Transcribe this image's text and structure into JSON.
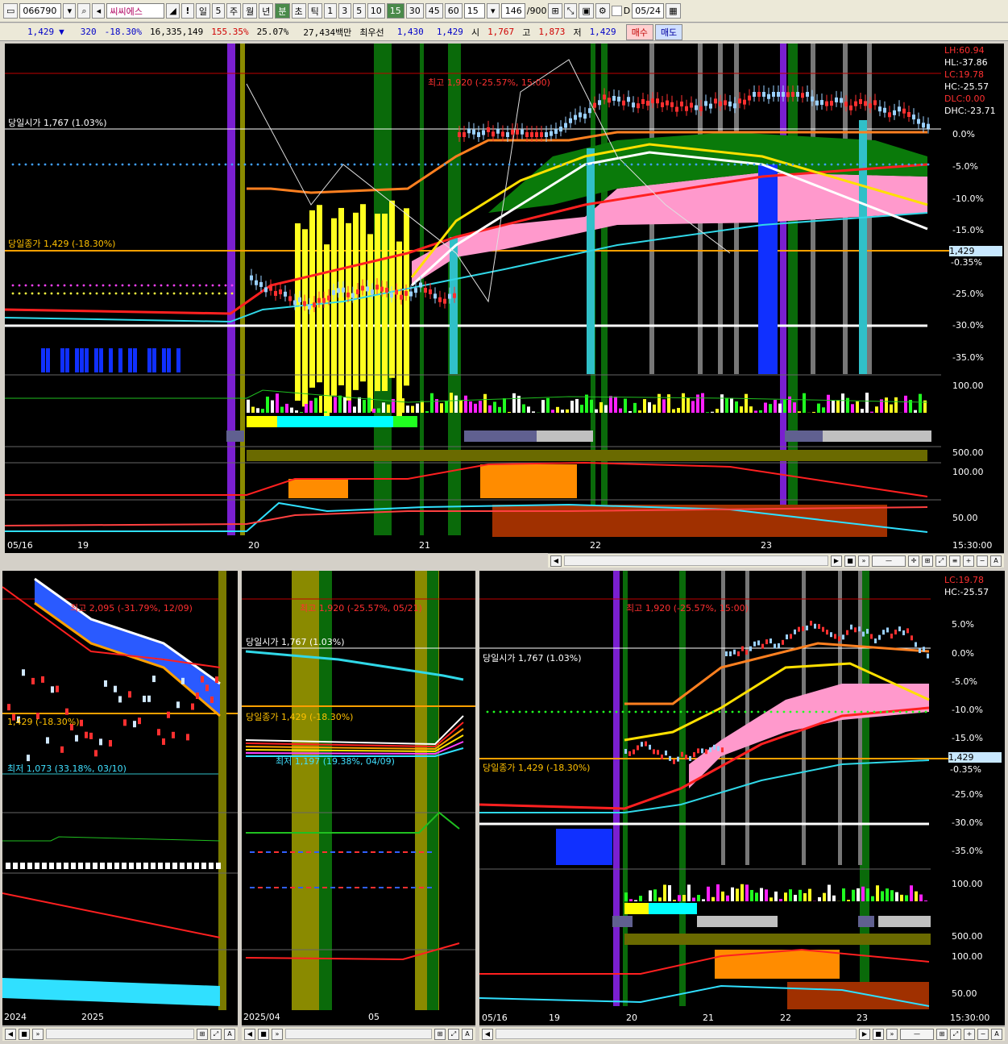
{
  "toolbar": {
    "code": "066790",
    "name": "씨씨에스",
    "periods": [
      "일",
      "5",
      "주",
      "월",
      "년",
      "분",
      "초",
      "틱"
    ],
    "intervals": [
      "1",
      "3",
      "5",
      "10",
      "15",
      "30",
      "45",
      "60"
    ],
    "interval_current": "15",
    "count": "146",
    "count_total": "/900",
    "date": "05/24",
    "checkbox_label": "D"
  },
  "quote": {
    "price": "1,429",
    "arrow": "▼",
    "change": "320",
    "change_pct": "-18.30%",
    "volume": "16,335,149",
    "volume_ratio": "155.35%",
    "turnover": "25.07%",
    "amount": "27,434백만",
    "best_bid_label": "최우선",
    "best_ask": "1,430",
    "best_bid": "1,429",
    "open_label": "시",
    "open": "1,767",
    "high_label": "고",
    "high": "1,873",
    "low_label": "저",
    "low": "1,429",
    "buy_label": "매수",
    "sell_label": "매도"
  },
  "main_chart": {
    "right_labels": [
      {
        "text": "LH:60.94",
        "color": "#ff3030"
      },
      {
        "text": "HL:-37.86",
        "color": "#ffffff"
      },
      {
        "text": "LC:19.78",
        "color": "#ff3030"
      },
      {
        "text": "HC:-25.57",
        "color": "#ffffff"
      },
      {
        "text": "DLC:0.00",
        "color": "#ff3030"
      },
      {
        "text": "DHC:-23.71",
        "color": "#ffffff"
      }
    ],
    "pct_ticks": [
      "0.0%",
      "-5.0%",
      "-10.0%",
      "-15.0%",
      "-25.0%",
      "-30.0%",
      "-35.0%"
    ],
    "price_tag": "1,429",
    "price_tag_pct": "-0.35%",
    "high_annotation": "최고 1,920 (-25.57%, 15:00)",
    "open_annotation": "당일시가 1,767 (1.03%)",
    "close_annotation": "당일종가 1,429 (-18.30%)",
    "sub_ticks": [
      "100.00",
      "500.00",
      "100.00",
      "50.00"
    ],
    "dates": [
      "05/16",
      "19",
      "20",
      "21",
      "22",
      "23"
    ],
    "time": "15:30:00"
  },
  "bottom_left": {
    "high_annotation": "최고 2,095 (-31.79%, 12/09)",
    "close_annotation": "1,429 (-18.30%)",
    "low_annotation": "최저 1,073 (33.18%, 03/10)",
    "dates": [
      "2024",
      "2025"
    ]
  },
  "bottom_mid": {
    "high_annotation": "최고 1,920 (-25.57%, 05/21)",
    "open_annotation": "당일시가 1,767 (1.03%)",
    "close_annotation": "당일종가 1,429 (-18.30%)",
    "low_annotation": "최저 1,197 (19.38%, 04/09)",
    "dates": [
      "2025/04",
      "05"
    ]
  },
  "bottom_right": {
    "right_labels": [
      {
        "text": "LC:19.78",
        "color": "#ff3030"
      },
      {
        "text": "HC:-25.57",
        "color": "#ffffff"
      }
    ],
    "pct_ticks": [
      "5.0%",
      "0.0%",
      "-5.0%",
      "-10.0%",
      "-15.0%",
      "-25.0%",
      "-30.0%",
      "-35.0%"
    ],
    "price_tag": "1,429",
    "price_tag_pct": "-0.35%",
    "high_annotation": "최고 1,920 (-25.57%, 15:00)",
    "open_annotation": "당일시가 1,767 (1.03%)",
    "close_annotation": "당일종가 1,429 (-18.30%)",
    "sub_ticks": [
      "100.00",
      "500.00",
      "100.00",
      "50.00"
    ],
    "dates": [
      "05/16",
      "19",
      "20",
      "21",
      "22",
      "23"
    ],
    "time": "15:30:00"
  }
}
